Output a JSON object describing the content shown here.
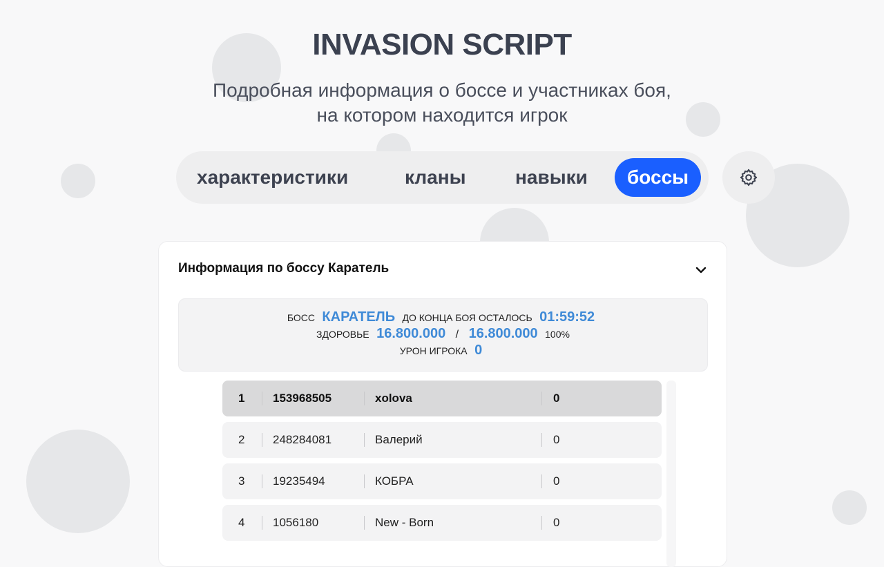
{
  "app": {
    "title": "INVASION SCRIPT",
    "subtitle_line1": "Подробная информация о боссе и участниках боя,",
    "subtitle_line2": "на котором находится игрок"
  },
  "nav": {
    "items": [
      {
        "label": "характеристики",
        "active": false
      },
      {
        "label": "кланы",
        "active": false
      },
      {
        "label": "навыки",
        "active": false
      },
      {
        "label": "боссы",
        "active": true
      }
    ],
    "settings_icon": "gear-icon",
    "accent_color": "#1a5fff"
  },
  "boss_panel": {
    "header": "Информация по боссу Каратель",
    "toggle_icon": "chevron-down-icon",
    "boss_label": "БОСС",
    "boss_name": "КАРАТЕЛЬ",
    "time_label": "ДО КОНЦА БОЯ ОСТАЛОСЬ",
    "time_left": "01:59:52",
    "health_label": "ЗДОРОВЬЕ",
    "health_current": "16.800.000",
    "health_separator": "/",
    "health_max": "16.800.000",
    "health_percent": "100%",
    "damage_label": "УРОН ИГРОКА",
    "damage_value": "0",
    "value_color": "#3f8ad7"
  },
  "participants": [
    {
      "rank": "1",
      "id": "153968505",
      "name": "xolova",
      "damage": "0",
      "highlighted": true
    },
    {
      "rank": "2",
      "id": "248284081",
      "name": "Валерий",
      "damage": "0",
      "highlighted": false
    },
    {
      "rank": "3",
      "id": "19235494",
      "name": "КОБРА",
      "damage": "0",
      "highlighted": false
    },
    {
      "rank": "4",
      "id": "1056180",
      "name": "New - Born",
      "damage": "0",
      "highlighted": false
    }
  ]
}
